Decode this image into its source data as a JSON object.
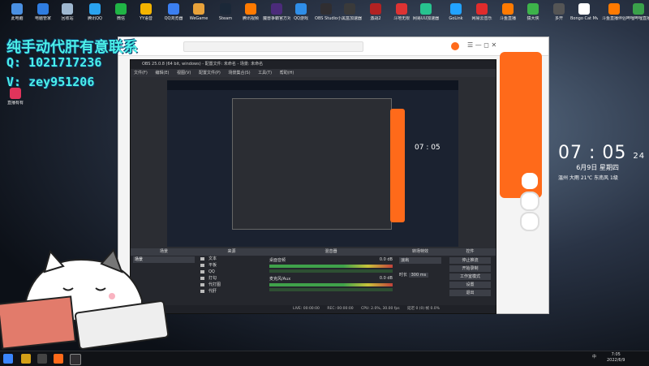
{
  "overlay": {
    "title": "纯手动代肝有意联系",
    "qq": "Q: 1021717236",
    "wechat": "V: zey951206"
  },
  "desktop_icons": [
    {
      "label": "此电脑",
      "color": "#4a90e2"
    },
    {
      "label": "电脑管家",
      "color": "#2f7de1"
    },
    {
      "label": "回收站",
      "color": "#9fb8d0"
    },
    {
      "label": "腾讯QQ",
      "color": "#2aa3ef"
    },
    {
      "label": "微信",
      "color": "#20b445"
    },
    {
      "label": "YY语音",
      "color": "#f4b400"
    },
    {
      "label": "QQ浏览器",
      "color": "#3b7ff1"
    },
    {
      "label": "WeGame",
      "color": "#e8a23a"
    },
    {
      "label": "Steam",
      "color": "#1b2838"
    },
    {
      "label": "腾讯视频",
      "color": "#ff7a00"
    },
    {
      "label": "魔兽争霸官方对战平台",
      "color": "#4b2b7a"
    },
    {
      "label": "QQ游戏",
      "color": "#2f8ee8"
    },
    {
      "label": "OBS Studio",
      "color": "#302e31"
    },
    {
      "label": "小黑盒加速器",
      "color": "#3a3a3a"
    },
    {
      "label": "激战2",
      "color": "#b22222"
    },
    {
      "label": "斗地无限",
      "color": "#d33"
    },
    {
      "label": "网易UU加速器",
      "color": "#27c38f"
    },
    {
      "label": "GoLink",
      "color": "#22a3ff"
    },
    {
      "label": "网易云音乐",
      "color": "#e02c2c"
    },
    {
      "label": "斗鱼直播",
      "color": "#ff7a00"
    },
    {
      "label": "猿大侠",
      "color": "#3db34a"
    },
    {
      "label": "多开",
      "color": "#555"
    },
    {
      "label": "Bongo Cat Mver",
      "color": "#fff"
    },
    {
      "label": "斗鱼直播伴侣",
      "color": "#ff7a00"
    },
    {
      "label": "哔哩哔哩直播",
      "color": "#3aa14a"
    }
  ],
  "desktop_icon_left": {
    "label": "直播有有",
    "color": "#e0345b"
  },
  "clock": {
    "time": "07 : 05",
    "seconds": "24",
    "date": "6月9日 星期四",
    "weather": "温州 大雨 21℃ 东南风 1级"
  },
  "obs": {
    "title": "OBS 25.0.8 (64 bit, windows) - 配置文件: 未命名 - 场景: 未命名",
    "menu": [
      "文件(F)",
      "编辑(E)",
      "视图(V)",
      "配置文件(P)",
      "场景集合(S)",
      "工具(T)",
      "帮助(H)"
    ],
    "docks": {
      "scenes": {
        "header": "场景",
        "item": "场景"
      },
      "sources": {
        "header": "来源",
        "items": [
          "文本",
          "平板",
          "QQ",
          "打勾",
          "代打图",
          "代肝"
        ]
      },
      "mixer": {
        "header": "混音器",
        "tracks": [
          {
            "name": "桌面音频",
            "db": "0.0 dB"
          },
          {
            "name": "麦克风/Aux",
            "db": "0.0 dB"
          }
        ]
      },
      "transitions": {
        "header": "转场特效",
        "type": "淡出",
        "duration_label": "时长",
        "duration": "300 ms"
      },
      "controls": {
        "header": "控件",
        "buttons": [
          "停止推流",
          "开始录制",
          "工作室模式",
          "设置",
          "退出"
        ]
      }
    },
    "status": {
      "live": "LIVE: 00:00:00",
      "rec": "REC: 00:00:00",
      "cpu": "CPU: 2.0%, 30.00 fps",
      "extra": "延迟 0 (0) 帧 0.0%"
    }
  },
  "taskbar": {
    "time": "7:05",
    "date": "2022/6/9",
    "lang": "中"
  }
}
